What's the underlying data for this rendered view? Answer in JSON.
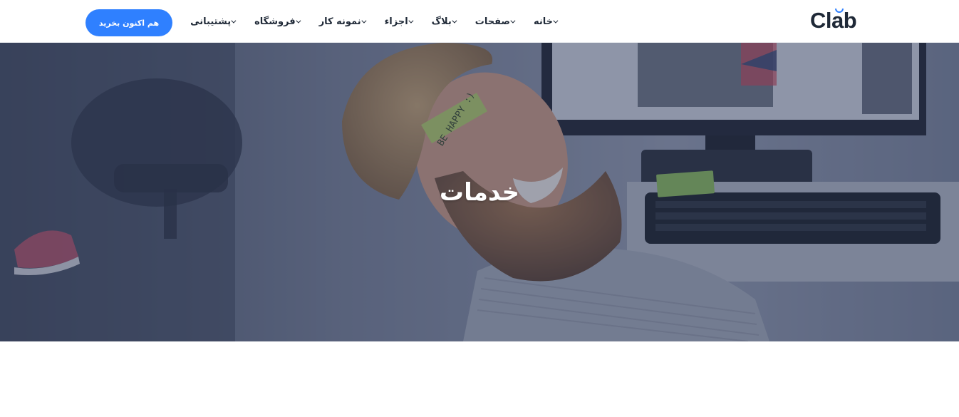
{
  "brand": {
    "logo_text": "Clab",
    "accent_color": "#2f80ff"
  },
  "nav": {
    "items": [
      {
        "label": "خانه",
        "icon": "chevron-down-icon"
      },
      {
        "label": "صفحات",
        "icon": "chevron-down-icon"
      },
      {
        "label": "بلاگ",
        "icon": "chevron-down-icon"
      },
      {
        "label": "اجزاء",
        "icon": "chevron-down-icon"
      },
      {
        "label": "نمونه کار",
        "icon": "chevron-down-icon"
      },
      {
        "label": "فروشگاه",
        "icon": "chevron-down-icon"
      },
      {
        "label": "پشتیبانی",
        "icon": "chevron-down-icon"
      }
    ],
    "cta_label": "هم اکنون بخرید"
  },
  "hero": {
    "title": "خدمات",
    "sticky_note_text": "BE HAPPY :)"
  }
}
